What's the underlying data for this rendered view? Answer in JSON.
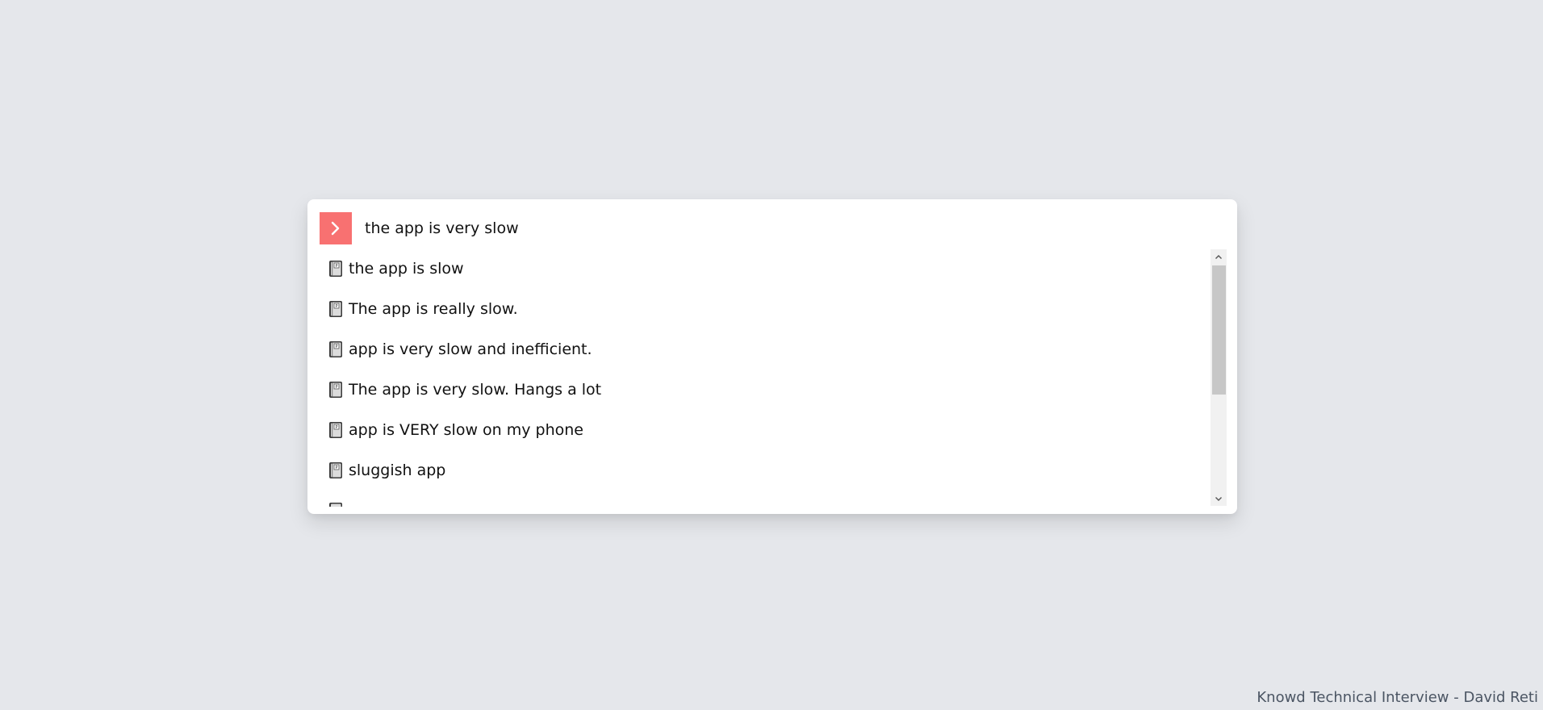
{
  "command_palette": {
    "search": {
      "value": "the app is very slow",
      "placeholder": ""
    },
    "results": [
      {
        "label": "the app is slow",
        "icon": "book-icon"
      },
      {
        "label": "The app is really slow.",
        "icon": "book-icon"
      },
      {
        "label": "app is very slow and inefficient.",
        "icon": "book-icon"
      },
      {
        "label": "The app is very slow. Hangs a lot",
        "icon": "book-icon"
      },
      {
        "label": "app is VERY slow on my phone",
        "icon": "book-icon"
      },
      {
        "label": "sluggish app",
        "icon": "book-icon"
      }
    ]
  },
  "footer": {
    "text": "Knowd Technical Interview - David Reti"
  },
  "colors": {
    "accent": "#f87171",
    "background": "#e5e7eb",
    "panel": "#ffffff"
  }
}
